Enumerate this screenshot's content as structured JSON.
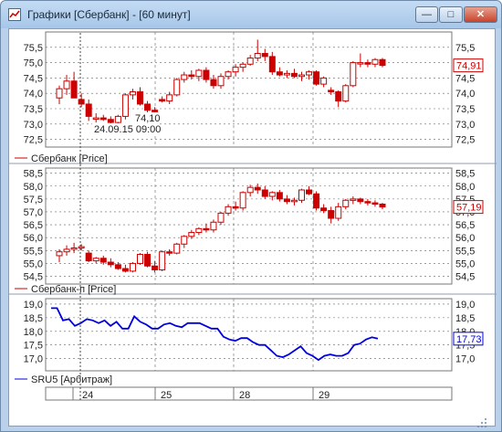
{
  "window": {
    "title": "Графики [Сбербанк] - [60 минут]",
    "minimize_glyph": "—",
    "maximize_glyph": "□",
    "close_glyph": "✕"
  },
  "colors": {
    "up": "#ffffff",
    "down": "#cc0000",
    "line": "#0000dd",
    "grid": "#666666"
  },
  "crosshair": {
    "value": "74,10",
    "datetime": "24.09.15 09:00"
  },
  "panels": [
    {
      "legend": "Сбербанк [Price]",
      "last_value": "74,91",
      "ticks": [
        "75,5",
        "75,0",
        "74,5",
        "74,0",
        "73,5",
        "73,0",
        "72,5"
      ],
      "tick_values": [
        75.5,
        75.0,
        74.5,
        74.0,
        73.5,
        73.0,
        72.5
      ],
      "ylim": [
        72.25,
        76.0
      ],
      "last_num": 74.91,
      "candles": [
        [
          73.85,
          74.25,
          73.65,
          74.15
        ],
        [
          74.15,
          74.6,
          73.95,
          74.4
        ],
        [
          74.4,
          74.7,
          74.0,
          73.85
        ],
        [
          73.8,
          74.0,
          73.55,
          73.65
        ],
        [
          73.65,
          73.8,
          73.1,
          73.25
        ],
        [
          73.2,
          73.35,
          73.05,
          73.2
        ],
        [
          73.2,
          73.3,
          73.1,
          73.15
        ],
        [
          73.15,
          73.25,
          72.95,
          73.05
        ],
        [
          73.05,
          73.3,
          72.95,
          73.25
        ],
        [
          73.25,
          74.0,
          73.15,
          73.95
        ],
        [
          73.95,
          74.15,
          73.8,
          74.05
        ],
        [
          74.05,
          74.2,
          73.6,
          73.65
        ],
        [
          73.65,
          73.75,
          73.35,
          73.45
        ],
        [
          73.45,
          73.55,
          73.3,
          73.4
        ],
        [
          73.8,
          73.9,
          73.7,
          73.75
        ],
        [
          73.75,
          74.05,
          73.65,
          73.95
        ],
        [
          73.95,
          74.5,
          73.9,
          74.45
        ],
        [
          74.45,
          74.7,
          74.35,
          74.6
        ],
        [
          74.6,
          74.75,
          74.45,
          74.55
        ],
        [
          74.55,
          74.8,
          74.4,
          74.75
        ],
        [
          74.75,
          74.85,
          74.35,
          74.45
        ],
        [
          74.45,
          74.6,
          74.15,
          74.25
        ],
        [
          74.25,
          74.65,
          74.15,
          74.55
        ],
        [
          74.55,
          74.75,
          74.45,
          74.7
        ],
        [
          74.7,
          74.95,
          74.55,
          74.85
        ],
        [
          74.85,
          75.0,
          74.7,
          74.95
        ],
        [
          74.95,
          75.25,
          74.9,
          75.15
        ],
        [
          75.15,
          75.75,
          75.05,
          75.3
        ],
        [
          75.3,
          75.45,
          75.05,
          75.2
        ],
        [
          75.2,
          75.35,
          74.6,
          74.7
        ],
        [
          74.7,
          74.85,
          74.55,
          74.6
        ],
        [
          74.6,
          74.75,
          74.5,
          74.65
        ],
        [
          74.65,
          74.8,
          74.5,
          74.55
        ],
        [
          74.55,
          74.7,
          74.4,
          74.6
        ],
        [
          74.6,
          74.75,
          74.45,
          74.7
        ],
        [
          74.7,
          74.75,
          74.25,
          74.3
        ],
        [
          74.3,
          74.55,
          74.2,
          74.5
        ],
        [
          74.1,
          74.2,
          73.95,
          74.05
        ],
        [
          74.05,
          74.1,
          73.55,
          73.75
        ],
        [
          73.75,
          74.3,
          73.7,
          74.25
        ],
        [
          74.25,
          75.05,
          74.2,
          75.0
        ],
        [
          75.0,
          75.3,
          74.85,
          75.0
        ],
        [
          75.0,
          75.1,
          74.85,
          74.95
        ],
        [
          74.95,
          75.15,
          74.85,
          75.1
        ],
        [
          75.1,
          75.15,
          74.85,
          74.91
        ]
      ]
    },
    {
      "legend": "Сбербанк-п [Price]",
      "last_value": "57,19",
      "ticks": [
        "58,5",
        "58,0",
        "57,5",
        "57,0",
        "56,5",
        "56,0",
        "55,5",
        "55,0",
        "54,5"
      ],
      "tick_values": [
        58.5,
        58.0,
        57.5,
        57.0,
        56.5,
        56.0,
        55.5,
        55.0,
        54.5
      ],
      "ylim": [
        54.2,
        58.7
      ],
      "last_num": 57.19,
      "candles": [
        [
          55.3,
          55.55,
          55.05,
          55.45
        ],
        [
          55.45,
          55.7,
          55.3,
          55.55
        ],
        [
          55.55,
          55.8,
          55.4,
          55.6
        ],
        [
          55.6,
          55.75,
          55.5,
          55.65
        ],
        [
          55.4,
          55.5,
          55.05,
          55.1
        ],
        [
          55.1,
          55.25,
          55.0,
          55.2
        ],
        [
          55.2,
          55.3,
          54.95,
          55.05
        ],
        [
          55.05,
          55.2,
          54.85,
          54.95
        ],
        [
          54.95,
          55.05,
          54.75,
          54.8
        ],
        [
          54.8,
          54.95,
          54.65,
          54.7
        ],
        [
          54.7,
          55.05,
          54.65,
          55.0
        ],
        [
          55.0,
          55.4,
          54.95,
          55.35
        ],
        [
          55.35,
          55.45,
          54.85,
          54.9
        ],
        [
          54.9,
          55.1,
          54.65,
          54.75
        ],
        [
          54.75,
          55.5,
          54.7,
          55.45
        ],
        [
          55.45,
          55.55,
          55.3,
          55.4
        ],
        [
          55.4,
          55.8,
          55.35,
          55.75
        ],
        [
          55.75,
          56.1,
          55.6,
          56.05
        ],
        [
          56.05,
          56.3,
          55.95,
          56.2
        ],
        [
          56.2,
          56.4,
          56.1,
          56.35
        ],
        [
          56.35,
          56.55,
          56.2,
          56.3
        ],
        [
          56.3,
          56.7,
          56.2,
          56.6
        ],
        [
          56.6,
          57.0,
          56.5,
          56.95
        ],
        [
          56.95,
          57.3,
          56.85,
          57.2
        ],
        [
          57.2,
          57.4,
          57.05,
          57.15
        ],
        [
          57.15,
          57.8,
          57.05,
          57.75
        ],
        [
          57.75,
          58.05,
          57.6,
          57.95
        ],
        [
          57.95,
          58.1,
          57.7,
          57.85
        ],
        [
          57.85,
          58.0,
          57.5,
          57.6
        ],
        [
          57.6,
          57.8,
          57.45,
          57.75
        ],
        [
          57.75,
          57.85,
          57.4,
          57.5
        ],
        [
          57.5,
          57.65,
          57.3,
          57.4
        ],
        [
          57.4,
          57.55,
          57.25,
          57.45
        ],
        [
          57.45,
          57.9,
          57.35,
          57.85
        ],
        [
          57.85,
          58.0,
          57.65,
          57.7
        ],
        [
          57.7,
          57.8,
          57.05,
          57.15
        ],
        [
          57.15,
          57.3,
          56.95,
          57.05
        ],
        [
          57.05,
          57.2,
          56.55,
          56.75
        ],
        [
          56.75,
          57.35,
          56.65,
          57.2
        ],
        [
          57.2,
          57.5,
          57.1,
          57.45
        ],
        [
          57.45,
          57.6,
          57.3,
          57.5
        ],
        [
          57.5,
          57.55,
          57.3,
          57.4
        ],
        [
          57.4,
          57.5,
          57.25,
          57.35
        ],
        [
          57.35,
          57.45,
          57.2,
          57.3
        ],
        [
          57.3,
          57.35,
          57.1,
          57.19
        ]
      ]
    },
    {
      "legend": "SRU5 [Арбитраж]",
      "last_value": "17,73",
      "ticks": [
        "19,0",
        "18,5",
        "18,0",
        "17,5",
        "17,0"
      ],
      "tick_values": [
        19.0,
        18.5,
        18.0,
        17.5,
        17.0
      ],
      "ylim": [
        16.55,
        19.2
      ],
      "last_num": 17.73,
      "line": [
        18.85,
        18.85,
        18.4,
        18.45,
        18.2,
        18.3,
        18.45,
        18.4,
        18.3,
        18.4,
        18.2,
        18.35,
        18.1,
        18.1,
        18.55,
        18.35,
        18.25,
        18.1,
        18.1,
        18.25,
        18.3,
        18.2,
        18.15,
        18.3,
        18.3,
        18.3,
        18.2,
        18.1,
        18.1,
        17.8,
        17.7,
        17.65,
        17.75,
        17.75,
        17.6,
        17.5,
        17.5,
        17.3,
        17.1,
        17.05,
        17.15,
        17.3,
        17.45,
        17.2,
        17.1,
        16.95,
        17.1,
        17.15,
        17.1,
        17.1,
        17.2,
        17.5,
        17.55,
        17.7,
        17.78,
        17.73
      ]
    }
  ],
  "x_axis": {
    "labels": [
      "24",
      "25",
      "28",
      "29"
    ]
  }
}
